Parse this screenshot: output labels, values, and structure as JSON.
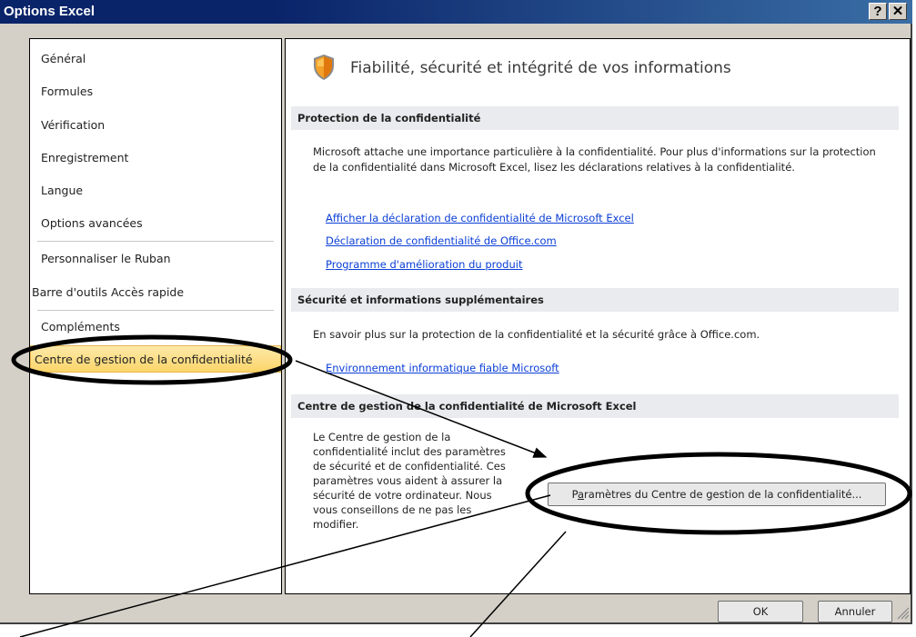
{
  "window": {
    "title": "Options Excel",
    "help_button": "?",
    "close_button": "✕"
  },
  "sidebar": {
    "items": [
      {
        "label": "Général"
      },
      {
        "label": "Formules"
      },
      {
        "label": "Vérification"
      },
      {
        "label": "Enregistrement"
      },
      {
        "label": "Langue"
      },
      {
        "label": "Options avancées"
      },
      {
        "label": "Personnaliser le Ruban"
      },
      {
        "label": "Barre d'outils Accès rapide"
      },
      {
        "label": "Compléments"
      },
      {
        "label": "Centre de gestion de la confidentialité",
        "selected": true
      }
    ]
  },
  "main": {
    "heading": "Fiabilité, sécurité et intégrité de vos informations",
    "heading_icon": "shield-icon",
    "privacy": {
      "title": "Protection de la confidentialité",
      "body": "Microsoft attache une importance particulière à la confidentialité. Pour plus d'informations sur la protection de la confidentialité dans Microsoft Excel, lisez les déclarations relatives à la confidentialité.",
      "links": [
        "Afficher la déclaration de confidentialité de Microsoft Excel",
        "Déclaration de confidentialité de Office.com",
        "Programme d'amélioration du produit"
      ]
    },
    "security": {
      "title": "Sécurité et informations supplémentaires",
      "body": "En savoir plus sur la protection de la confidentialité et la sécurité grâce à Office.com.",
      "link": "Environnement informatique fiable Microsoft"
    },
    "trust_center": {
      "title": "Centre de gestion de la confidentialité de Microsoft Excel",
      "lines": [
        "Le Centre de gestion de la",
        "confidentialité inclut des paramètres",
        "de sécurité et de confidentialité. Ces",
        "paramètres vous aident à assurer la",
        "sécurité de votre ordinateur. Nous",
        "vous conseillons de ne pas les",
        "modifier."
      ],
      "button_before": "P",
      "button_mnemonic": "a",
      "button_after": "ramètres du Centre de gestion de la confidentialité..."
    }
  },
  "footer": {
    "ok_label": "OK",
    "cancel_label": "Annuler"
  },
  "colors": {
    "title_bar": "#0a246a",
    "selection": "#fbd56a",
    "link": "#0a3ed6"
  }
}
